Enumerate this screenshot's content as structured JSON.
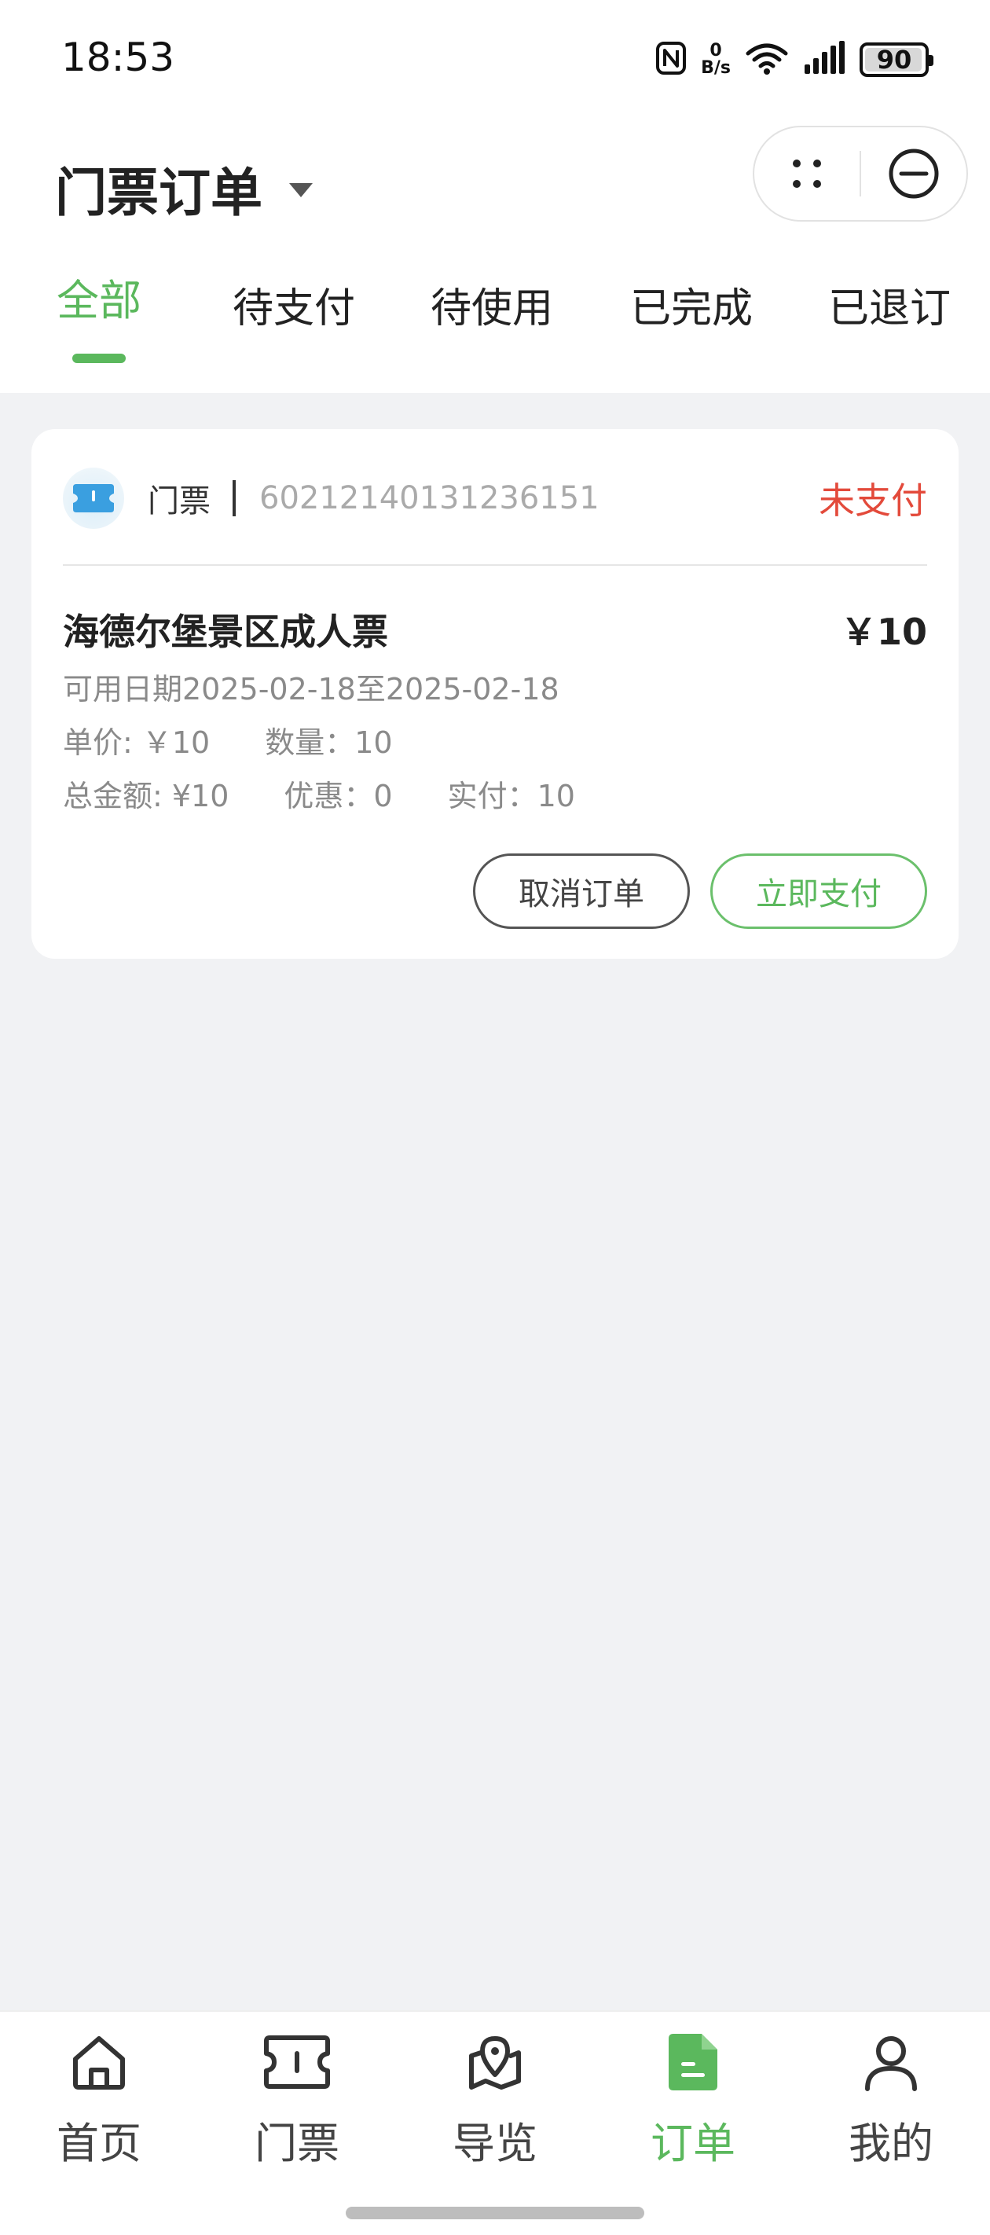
{
  "status_bar": {
    "time": "18:53",
    "net_speed_value": "0",
    "net_speed_unit": "B/s",
    "battery_level": "90",
    "icons": [
      "nfc-icon",
      "wifi-icon",
      "signal-icon",
      "battery-icon"
    ]
  },
  "header": {
    "title": "门票订单",
    "capsule_icons": [
      "more-dots-icon",
      "close-circle-icon"
    ]
  },
  "tabs": [
    {
      "label": "全部",
      "active": true
    },
    {
      "label": "待支付",
      "active": false
    },
    {
      "label": "待使用",
      "active": false
    },
    {
      "label": "已完成",
      "active": false
    },
    {
      "label": "已退订",
      "active": false
    }
  ],
  "order": {
    "category": "门票",
    "order_no": "60212140131236151",
    "status": "未支付",
    "product_name": "海德尔堡景区成人票",
    "price": "￥10",
    "valid_dates": "可用日期2025-02-18至2025-02-18",
    "unit_price": "单价: ￥10",
    "quantity": "数量：10",
    "total": "总金额: ¥10",
    "discount": "优惠：0",
    "paid": "实付：10",
    "cancel_label": "取消订单",
    "pay_label": "立即支付"
  },
  "bottom_nav": [
    {
      "label": "首页",
      "icon": "home-icon",
      "active": false
    },
    {
      "label": "门票",
      "icon": "ticket-icon",
      "active": false
    },
    {
      "label": "导览",
      "icon": "map-guide-icon",
      "active": false
    },
    {
      "label": "订单",
      "icon": "order-document-icon",
      "active": true
    },
    {
      "label": "我的",
      "icon": "profile-icon",
      "active": false
    }
  ],
  "colors": {
    "accent": "#5BB85D",
    "status_unpaid": "#E34A3B",
    "background": "#F1F2F4"
  }
}
